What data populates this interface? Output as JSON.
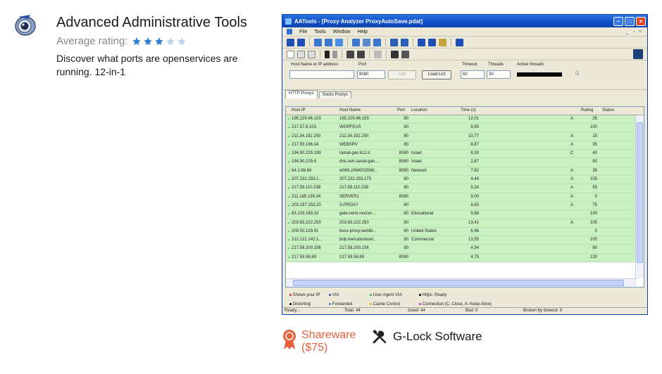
{
  "app": {
    "title": "Advanced Administrative Tools",
    "rating_label": "Average rating:",
    "rating": 3,
    "rating_max": 5,
    "description": "Discover what ports are openservices are running. 12-in-1"
  },
  "license": {
    "type": "Shareware",
    "price": "($75)"
  },
  "vendor": {
    "name": "G-Lock Software"
  },
  "colors": {
    "star_filled": "#2f7fd8",
    "star_empty": "#b9d4ef",
    "license": "#e8603c",
    "row_ok": "#c8f0c0"
  },
  "screenshot": {
    "window_title": "AATools - [Proxy Analyzer  ProxyAutoSave.pdat]",
    "menu": [
      "File",
      "Tools",
      "Window",
      "Help"
    ],
    "form": {
      "host_label": "Host Name or IP address",
      "port_label": "Port",
      "port_value": "8080",
      "add_button": "Add",
      "load_button": "Load List",
      "timeout_label": "Timeout",
      "timeout_value": "60",
      "threads_label": "Threads",
      "threads_value": "30",
      "active_threads_label": "Active threads:",
      "active_threads_value": "0"
    },
    "tabs": [
      "HTTP Proxys",
      "Socks Proxys"
    ],
    "columns": [
      "Host IP",
      "Host Name",
      "Port",
      "Location",
      "Time (s)",
      "Rating",
      "Status"
    ],
    "rows": [
      {
        "ip": "195.229.46.103",
        "name": "195.229.46.103",
        "port": "80",
        "loc": "",
        "time": "12,01",
        "grade": "A",
        "rating": "35"
      },
      {
        "ip": "217.57.8.103",
        "name": "WORFEUS",
        "port": "80",
        "loc": "",
        "time": "8,69",
        "grade": "",
        "rating": "100"
      },
      {
        "ip": "211.34.192.250",
        "name": "211.34.192.250",
        "port": "80",
        "loc": "",
        "time": "10,77",
        "grade": "A",
        "rating": "15"
      },
      {
        "ip": "217.59.196.34",
        "name": "WEBSRV",
        "port": "80",
        "loc": "",
        "time": "8,87",
        "grade": "A",
        "rating": "35"
      },
      {
        "ip": "194.90.229.199",
        "name": "ramat-gan.k12.il",
        "port": "8080",
        "loc": "Israel",
        "time": "8,30",
        "grade": "C",
        "rating": "40"
      },
      {
        "ip": "194.90.229.6",
        "name": "dns.ooh.ramat-gan...",
        "port": "8080",
        "loc": "Israel",
        "time": "2,87",
        "grade": "",
        "rating": "80"
      },
      {
        "ip": "64.2.88.66",
        "name": "w066.z064002088...",
        "port": "8080",
        "loc": "Network",
        "time": "7,82",
        "grade": "A",
        "rating": "35"
      },
      {
        "ip": "207.232.253.1...",
        "name": "207.232.253.175",
        "port": "80",
        "loc": "",
        "time": "4,44",
        "grade": "A",
        "rating": "105"
      },
      {
        "ip": "217.58.110.238",
        "name": "217.58.110.238",
        "port": "80",
        "loc": "",
        "time": "5,24",
        "grade": "A",
        "rating": "55"
      },
      {
        "ip": "211.185.199.34",
        "name": "SERVER1",
        "port": "8080",
        "loc": "",
        "time": "9,00",
        "grade": "A",
        "rating": "0"
      },
      {
        "ip": "203.197.253.20",
        "name": "S-PROXY",
        "port": "80",
        "loc": "",
        "time": "6,63",
        "grade": "A",
        "rating": "75"
      },
      {
        "ip": "63.103.169.10",
        "name": "gate.nemi.nericer...",
        "port": "80",
        "loc": "Educational",
        "time": "5,88",
        "grade": "",
        "rating": "100"
      },
      {
        "ip": "203.83.222.250",
        "name": "203.83.222.250",
        "port": "80",
        "loc": "",
        "time": "13,42",
        "grade": "A",
        "rating": "105"
      },
      {
        "ip": "209.50.129.91",
        "name": "bess-proxy.weblib...",
        "port": "80",
        "loc": "United States",
        "time": "6,96",
        "grade": "",
        "rating": "0"
      },
      {
        "ip": "212.131.242.1...",
        "name": "bob.mercatonezet...",
        "port": "80",
        "loc": "Commercial",
        "time": "13,55",
        "grade": "",
        "rating": "100"
      },
      {
        "ip": "217.58.200.156",
        "name": "217.58.200.156",
        "port": "80",
        "loc": "",
        "time": "4,54",
        "grade": "",
        "rating": "80"
      },
      {
        "ip": "217.59.56.69",
        "name": "217.59.56.69",
        "port": "8080",
        "loc": "",
        "time": "4,75",
        "grade": "",
        "rating": "120"
      }
    ],
    "legend": [
      "Shows your IP",
      "VIA",
      "User Agent VIA",
      "Https: Ready",
      "Distorting",
      "Forwarded",
      "Cache Control",
      "Connection (C: Close, A: Keep-Alive)"
    ],
    "status": {
      "state": "Ready...",
      "total": "Total: 44",
      "good": "Good: 44",
      "bad": "Bad: 0",
      "broken": "Broken by timeout: 0"
    }
  }
}
